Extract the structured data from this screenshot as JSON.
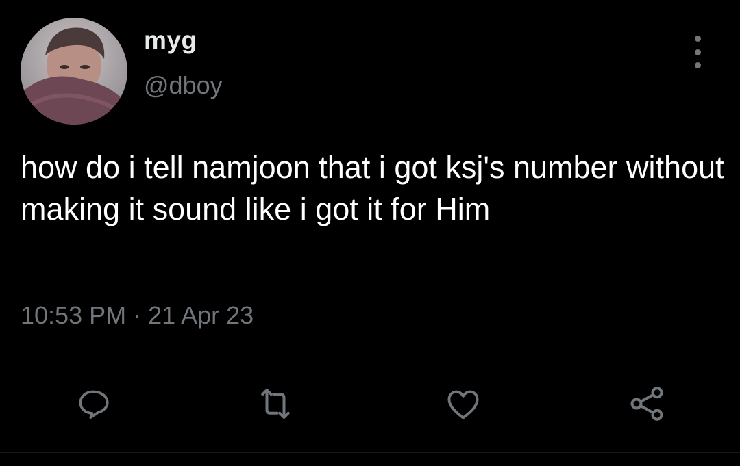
{
  "tweet": {
    "author": {
      "display_name": "myg",
      "handle": "@dboy"
    },
    "text": "how do i tell namjoon that i got ksj's number without making it sound like i got it for Him",
    "timestamp": "10:53 PM · 21 Apr 23"
  },
  "actions": {
    "reply": "reply-icon",
    "retweet": "retweet-icon",
    "like": "heart-icon",
    "share": "share-icon"
  },
  "colors": {
    "background": "#000000",
    "primary_text": "#e7e9ea",
    "secondary_text": "#71767b",
    "divider": "#2f3336"
  }
}
